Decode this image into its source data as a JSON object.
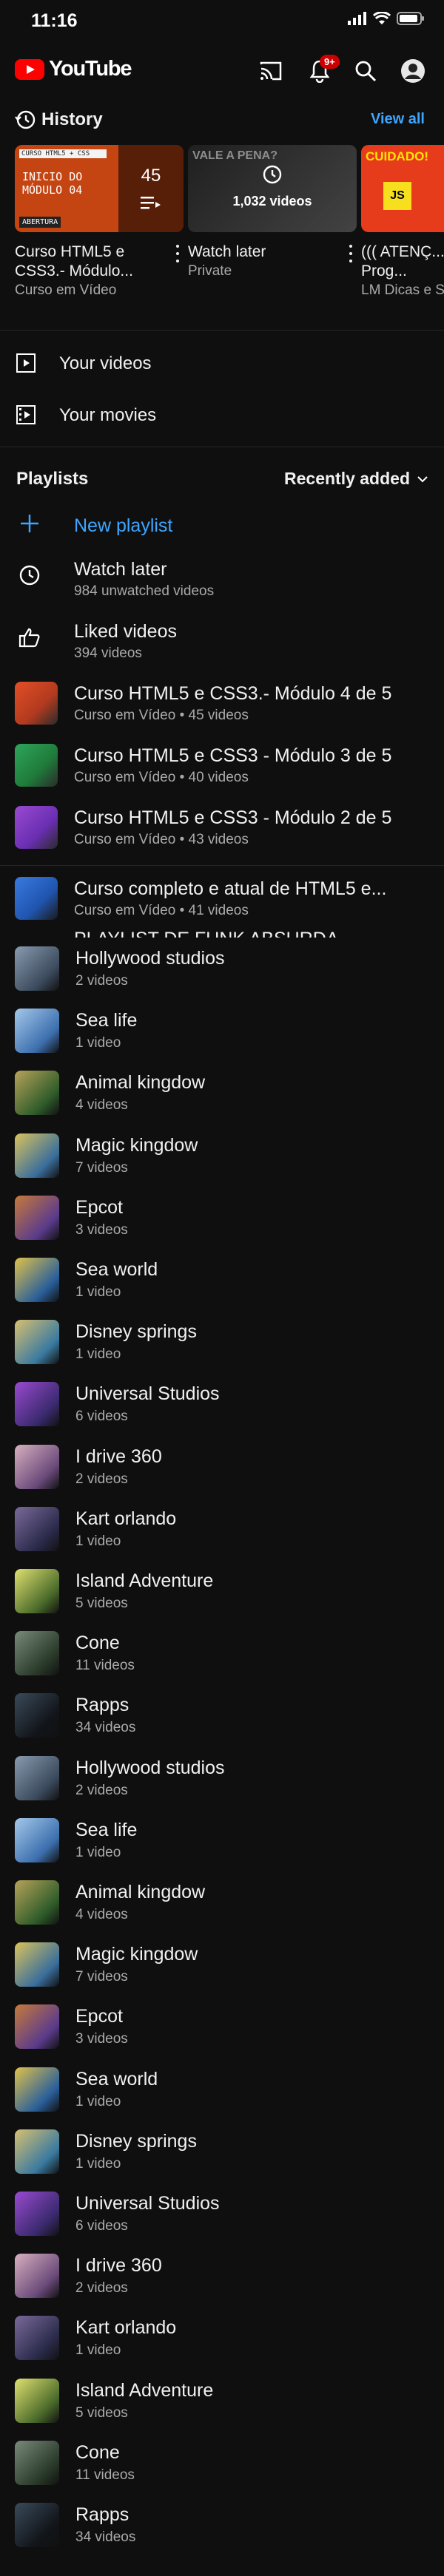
{
  "status": {
    "time": "11:16"
  },
  "app": {
    "name": "YouTube",
    "notifications": "9+"
  },
  "history": {
    "title": "History",
    "view_all": "View all",
    "cards": [
      {
        "title": "Curso HTML5 e CSS3.- Módulo...",
        "sub": "Curso em Vídeo",
        "thumb_line1": "CURSO HTML5 + CSS",
        "thumb_line2": "INICIO DO",
        "thumb_line3": "MÓDULO 04",
        "thumb_tag": "ABERTURA",
        "count": "45"
      },
      {
        "title": "Watch later",
        "sub": "Private",
        "thumb_top": "VALE A PENA?",
        "count": "1,032 videos"
      },
      {
        "title": "((( ATENÇ... Curso Prog...",
        "sub": "LM Dicas e S...",
        "thumb_top": "CUIDADO!",
        "thumb_badge": "JS"
      }
    ]
  },
  "library": [
    {
      "label": "Your videos",
      "icon": "play-icon"
    },
    {
      "label": "Your movies",
      "icon": "film-icon"
    }
  ],
  "playlists": {
    "title": "Playlists",
    "sort": "Recently added",
    "new": "New playlist",
    "items": [
      {
        "title": "Watch later",
        "sub": "984 unwatched videos",
        "icon": "clock-icon"
      },
      {
        "title": "Liked videos",
        "sub": "394 videos",
        "icon": "thumbs-up-icon"
      },
      {
        "title": "Curso HTML5 e CSS3.- Módulo 4 de 5",
        "sub": "Curso em Vídeo • 45 videos",
        "color": "#b13a1f"
      },
      {
        "title": "Curso HTML5 e CSS3 - Módulo 3 de 5",
        "sub": "Curso em Vídeo • 40 videos",
        "color": "#1f7a3a"
      },
      {
        "title": "Curso HTML5 e CSS3 - Módulo 2 de 5",
        "sub": "Curso em Vídeo • 43 videos",
        "color": "#6a2fb3"
      },
      {
        "title": "Curso completo e atual de HTML5 e...",
        "sub": "Curso em Vídeo • 41 videos",
        "color": "#2055b0"
      }
    ],
    "partial": "PLAYLIST DE FUNK ABSURDA"
  },
  "collections": [
    {
      "title": "Hollywood studios",
      "sub": "2 videos",
      "c1": "#3b4a5c",
      "c2": "#8a9bb0"
    },
    {
      "title": "Sea life",
      "sub": "1 video",
      "c1": "#3c6fae",
      "c2": "#a5c8ea"
    },
    {
      "title": "Animal kingdow",
      "sub": "4 videos",
      "c1": "#2f5c2a",
      "c2": "#b7a35a"
    },
    {
      "title": "Magic kingdow",
      "sub": "7 videos",
      "c1": "#3a6e9c",
      "c2": "#d9c35c"
    },
    {
      "title": "Epcot",
      "sub": "3 videos",
      "c1": "#5a3b8c",
      "c2": "#c77a3a"
    },
    {
      "title": "Sea world",
      "sub": "1 video",
      "c1": "#2a5f9a",
      "c2": "#e0c24a"
    },
    {
      "title": "Disney springs",
      "sub": "1 video",
      "c1": "#3a7aa0",
      "c2": "#d8c070"
    },
    {
      "title": "Universal Studios",
      "sub": "6 videos",
      "c1": "#3a2a6e",
      "c2": "#9a4ad0"
    },
    {
      "title": "I drive 360",
      "sub": "2 videos",
      "c1": "#6a4a7a",
      "c2": "#d8b0c0"
    },
    {
      "title": "Kart orlando",
      "sub": "1 video",
      "c1": "#2a2a4a",
      "c2": "#7a6a9a"
    },
    {
      "title": "Island Adventure",
      "sub": "5 videos",
      "c1": "#4a6a2a",
      "c2": "#e0e070"
    },
    {
      "title": "Cone",
      "sub": "11 videos",
      "c1": "#2a3a2a",
      "c2": "#7a8a7a"
    },
    {
      "title": "Rapps",
      "sub": "34 videos",
      "c1": "#111418",
      "c2": "#3a4a5a"
    },
    {
      "title": "Hollywood studios",
      "sub": "2 videos",
      "c1": "#3b4a5c",
      "c2": "#8a9bb0"
    },
    {
      "title": "Sea life",
      "sub": "1 video",
      "c1": "#3c6fae",
      "c2": "#a5c8ea"
    },
    {
      "title": "Animal kingdow",
      "sub": "4 videos",
      "c1": "#2f5c2a",
      "c2": "#b7a35a"
    },
    {
      "title": "Magic kingdow",
      "sub": "7 videos",
      "c1": "#3a6e9c",
      "c2": "#d9c35c"
    },
    {
      "title": "Epcot",
      "sub": "3 videos",
      "c1": "#5a3b8c",
      "c2": "#c77a3a"
    },
    {
      "title": "Sea world",
      "sub": "1 video",
      "c1": "#2a5f9a",
      "c2": "#e0c24a"
    },
    {
      "title": "Disney springs",
      "sub": "1 video",
      "c1": "#3a7aa0",
      "c2": "#d8c070"
    },
    {
      "title": "Universal Studios",
      "sub": "6 videos",
      "c1": "#3a2a6e",
      "c2": "#9a4ad0"
    },
    {
      "title": "I drive 360",
      "sub": "2 videos",
      "c1": "#6a4a7a",
      "c2": "#d8b0c0"
    },
    {
      "title": "Kart orlando",
      "sub": "1 video",
      "c1": "#2a2a4a",
      "c2": "#7a6a9a"
    },
    {
      "title": "Island Adventure",
      "sub": "5 videos",
      "c1": "#4a6a2a",
      "c2": "#e0e070"
    },
    {
      "title": "Cone",
      "sub": "11 videos",
      "c1": "#2a3a2a",
      "c2": "#7a8a7a"
    },
    {
      "title": "Rapps",
      "sub": "34 videos",
      "c1": "#111418",
      "c2": "#3a4a5a"
    }
  ],
  "colors": {
    "accent": "#3ea6ff",
    "brand": "#ff0000",
    "background": "#0f0f0f"
  }
}
